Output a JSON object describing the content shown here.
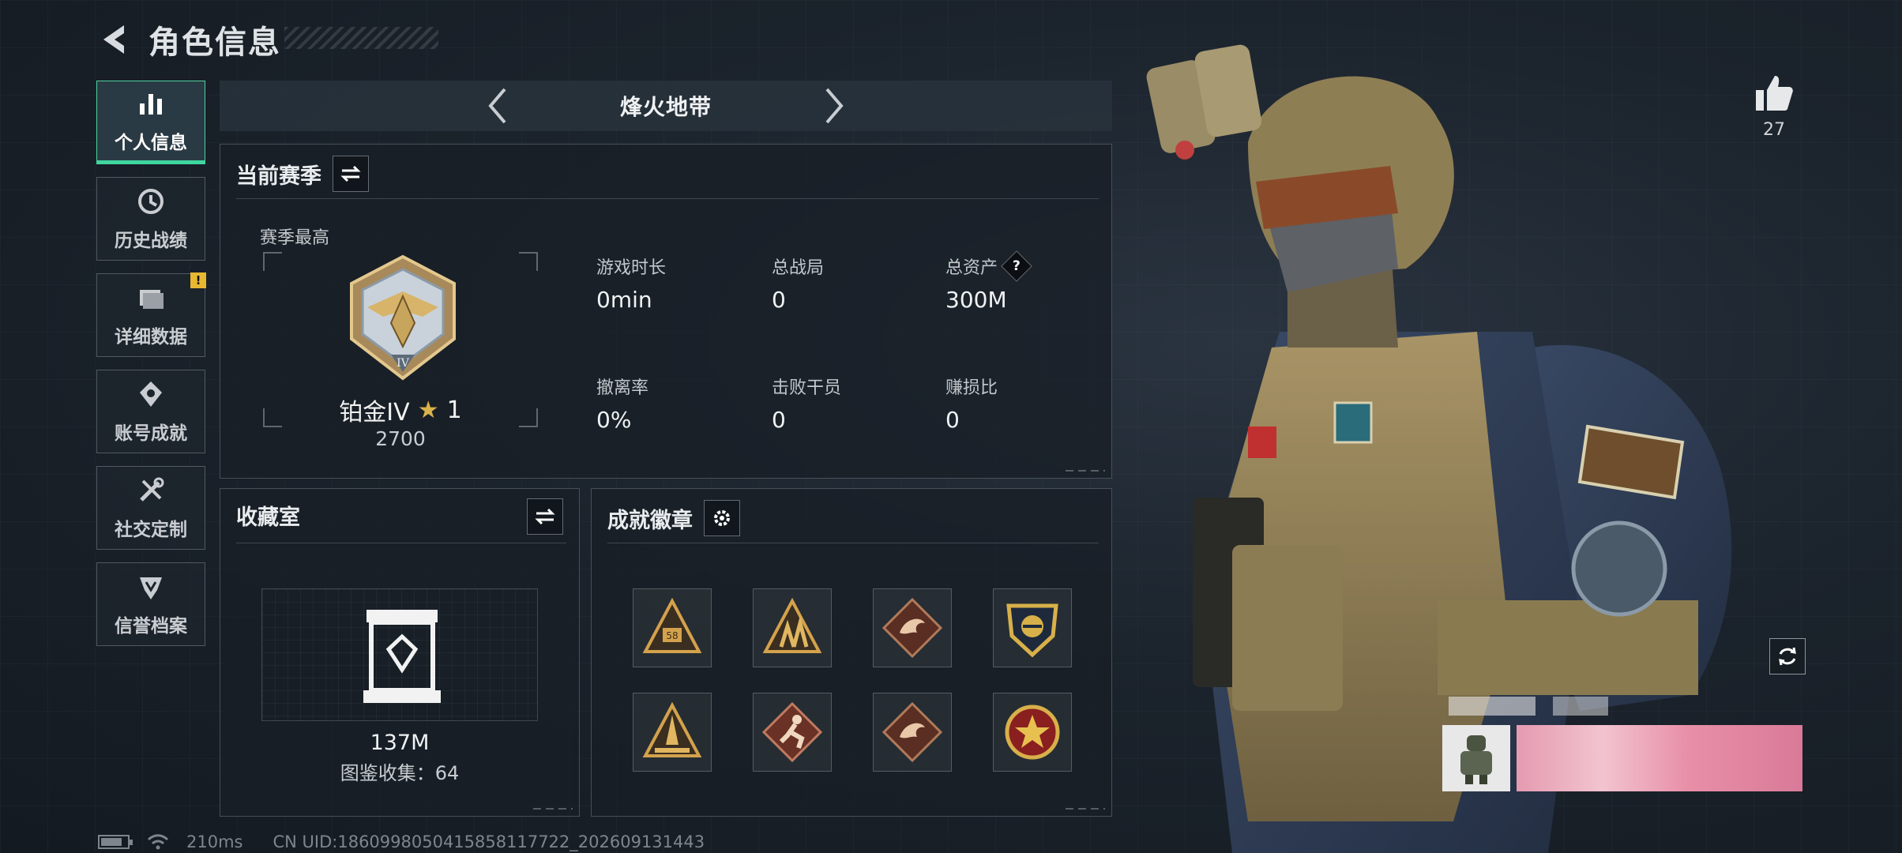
{
  "header": {
    "title": "角色信息"
  },
  "sidebar": {
    "items": [
      {
        "label": "个人信息",
        "icon": "bar-chart-icon",
        "active": true,
        "alert": ""
      },
      {
        "label": "历史战绩",
        "icon": "history-icon",
        "active": false,
        "alert": ""
      },
      {
        "label": "详细数据",
        "icon": "folder-icon",
        "active": false,
        "alert": "!"
      },
      {
        "label": "账号成就",
        "icon": "achievement-icon",
        "active": false,
        "alert": ""
      },
      {
        "label": "社交定制",
        "icon": "tools-icon",
        "active": false,
        "alert": ""
      },
      {
        "label": "信誉档案",
        "icon": "reputation-icon",
        "active": false,
        "alert": ""
      }
    ]
  },
  "mode": {
    "title": "烽火地带"
  },
  "season": {
    "title": "当前赛季",
    "best_label": "赛季最高",
    "rank_name": "铂金IV",
    "rank_stars": "1",
    "rank_score": "2700",
    "stats": [
      {
        "label": "游戏时长",
        "value": "0min"
      },
      {
        "label": "总战局",
        "value": "0"
      },
      {
        "label": "总资产",
        "value": "300M",
        "help": "?"
      },
      {
        "label": "撤离率",
        "value": "0%"
      },
      {
        "label": "击败干员",
        "value": "0"
      },
      {
        "label": "赚损比",
        "value": "0"
      }
    ]
  },
  "collection": {
    "title": "收藏室",
    "value": "137M",
    "count_text": "图鉴收集：64"
  },
  "achievements": {
    "title": "成就徽章",
    "badges": [
      "triangle-58-badge",
      "triangle-soldiers-badge",
      "dragon-diamond-badge",
      "shield-gold-badge",
      "rocket-triangle-badge",
      "runner-diamond-badge",
      "dragon-diamond-badge-2",
      "star-round-badge"
    ]
  },
  "like": {
    "count": "27"
  },
  "footer": {
    "ping": "210ms",
    "uid": "CN UID:1860998050415858117722_202609131443"
  },
  "colors": {
    "accent": "#3fd5a0",
    "alert": "#e8b830",
    "gold": "#d9b24a"
  }
}
